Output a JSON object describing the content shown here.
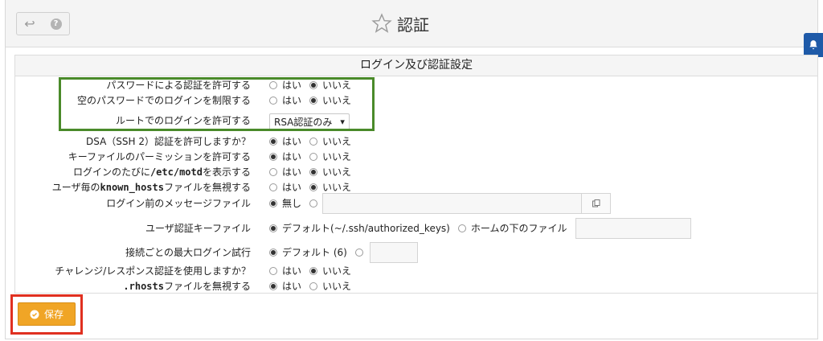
{
  "header": {
    "title": "認証",
    "back_icon": "back-arrow-icon",
    "help_icon": "help-icon",
    "star_icon": "star-icon"
  },
  "panel": {
    "title": "ログイン及び認証設定"
  },
  "settings": [
    {
      "label": "パスワードによる認証を許可する",
      "type": "radio",
      "options": [
        "はい",
        "いいえ"
      ],
      "selected": 1
    },
    {
      "label": "空のパスワードでのログインを制限する",
      "type": "radio",
      "options": [
        "はい",
        "いいえ"
      ],
      "selected": 1
    },
    {
      "label": "ルートでのログインを許可する",
      "type": "select",
      "value": "RSA認証のみ"
    },
    {
      "label_pre": "DSA（SSH 2）認証を許可しますか？",
      "type": "radio",
      "options": [
        "はい",
        "いいえ"
      ],
      "selected": 0
    },
    {
      "label": "キーファイルのパーミッションを許可する",
      "type": "radio",
      "options": [
        "はい",
        "いいえ"
      ],
      "selected": 0
    },
    {
      "label_pre": "ログインのたびに",
      "label_code": "/etc/motd",
      "label_post": "を表示する",
      "type": "radio",
      "options": [
        "はい",
        "いいえ"
      ],
      "selected": 1
    },
    {
      "label_pre": "ユーザ毎の",
      "label_code": "known_hosts",
      "label_post": "ファイルを無視する",
      "type": "radio",
      "options": [
        "はい",
        "いいえ"
      ],
      "selected": 1
    },
    {
      "label": "ログイン前のメッセージファイル",
      "type": "radio-file",
      "options": [
        "無し",
        ""
      ],
      "selected": 0,
      "browse_icon": "file-browse-icon"
    },
    {
      "label": "ユーザ認証キーファイル",
      "type": "radio-field",
      "options": [
        "デフォルト(~/.ssh/authorized_keys)",
        "ホームの下のファイル"
      ],
      "selected": 0
    },
    {
      "label": "接続ごとの最大ログイン試行",
      "type": "radio-field",
      "options": [
        "デフォルト (6)",
        ""
      ],
      "selected": 0
    },
    {
      "label": "チャレンジ/レスポンス認証を使用しますか？",
      "type": "radio",
      "options": [
        "はい",
        "いいえ"
      ],
      "selected": 1
    },
    {
      "label_code": ".rhosts",
      "label_post": "ファイルを無視する",
      "type": "radio",
      "options": [
        "はい",
        "いいえ"
      ],
      "selected": 0
    }
  ],
  "save": {
    "label": "保存",
    "icon": "check-circle-icon"
  },
  "colors": {
    "save": "#f0a526",
    "highlight_green": "#4a8a2a",
    "highlight_red": "#e03020",
    "notify": "#1e5aa8"
  }
}
